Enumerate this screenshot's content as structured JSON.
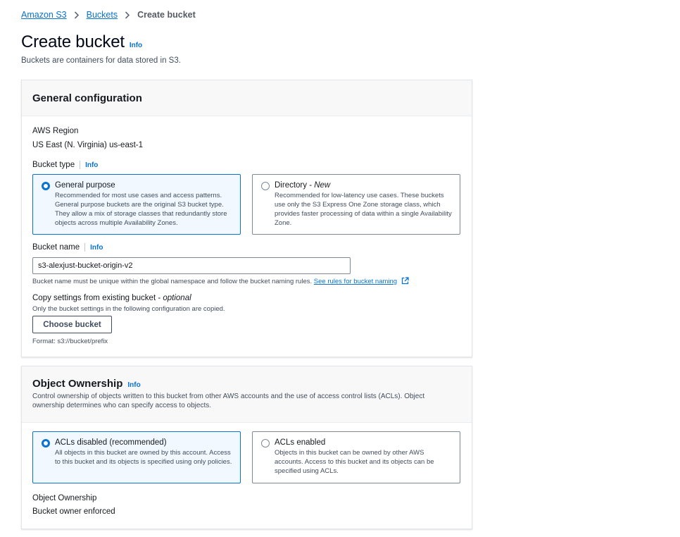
{
  "breadcrumb": {
    "items": [
      "Amazon S3",
      "Buckets"
    ],
    "current": "Create bucket"
  },
  "page": {
    "title": "Create bucket",
    "info": "Info",
    "subtitle": "Buckets are containers for data stored in S3."
  },
  "general_config": {
    "title": "General configuration",
    "region_label": "AWS Region",
    "region_value": "US East (N. Virginia) us-east-1",
    "bucket_type_label": "Bucket type",
    "info": "Info",
    "bucket_types": [
      {
        "title": "General purpose",
        "desc": "Recommended for most use cases and access patterns. General purpose buckets are the original S3 bucket type. They allow a mix of storage classes that redundantly store objects across multiple Availability Zones.",
        "selected": true
      },
      {
        "title": "Directory - ",
        "title_suffix": "New",
        "desc": "Recommended for low-latency use cases. These buckets use only the S3 Express One Zone storage class, which provides faster processing of data within a single Availability Zone.",
        "selected": false
      }
    ],
    "bucket_name_label": "Bucket name",
    "bucket_name_value": "s3-alexjust-bucket-origin-v2",
    "bucket_name_hint": "Bucket name must be unique within the global namespace and follow the bucket naming rules.",
    "bucket_name_link": "See rules for bucket naming",
    "copy_label": "Copy settings from existing bucket - ",
    "copy_label_optional": "optional",
    "copy_desc": "Only the bucket settings in the following configuration are copied.",
    "choose_button": "Choose bucket",
    "format_hint": "Format: s3://bucket/prefix"
  },
  "object_ownership": {
    "title": "Object Ownership",
    "info": "Info",
    "desc": "Control ownership of objects written to this bucket from other AWS accounts and the use of access control lists (ACLs). Object ownership determines who can specify access to objects.",
    "options": [
      {
        "title": "ACLs disabled (recommended)",
        "desc": "All objects in this bucket are owned by this account. Access to this bucket and its objects is specified using only policies.",
        "selected": true
      },
      {
        "title": "ACLs enabled",
        "desc": "Objects in this bucket can be owned by other AWS accounts. Access to this bucket and its objects can be specified using ACLs.",
        "selected": false
      }
    ],
    "ownership_label": "Object Ownership",
    "ownership_value": "Bucket owner enforced"
  },
  "colors": {
    "link": "#0972d3",
    "selected_border": "#0972d3",
    "selected_bg": "#f1f8ff",
    "text": "#16191f"
  }
}
